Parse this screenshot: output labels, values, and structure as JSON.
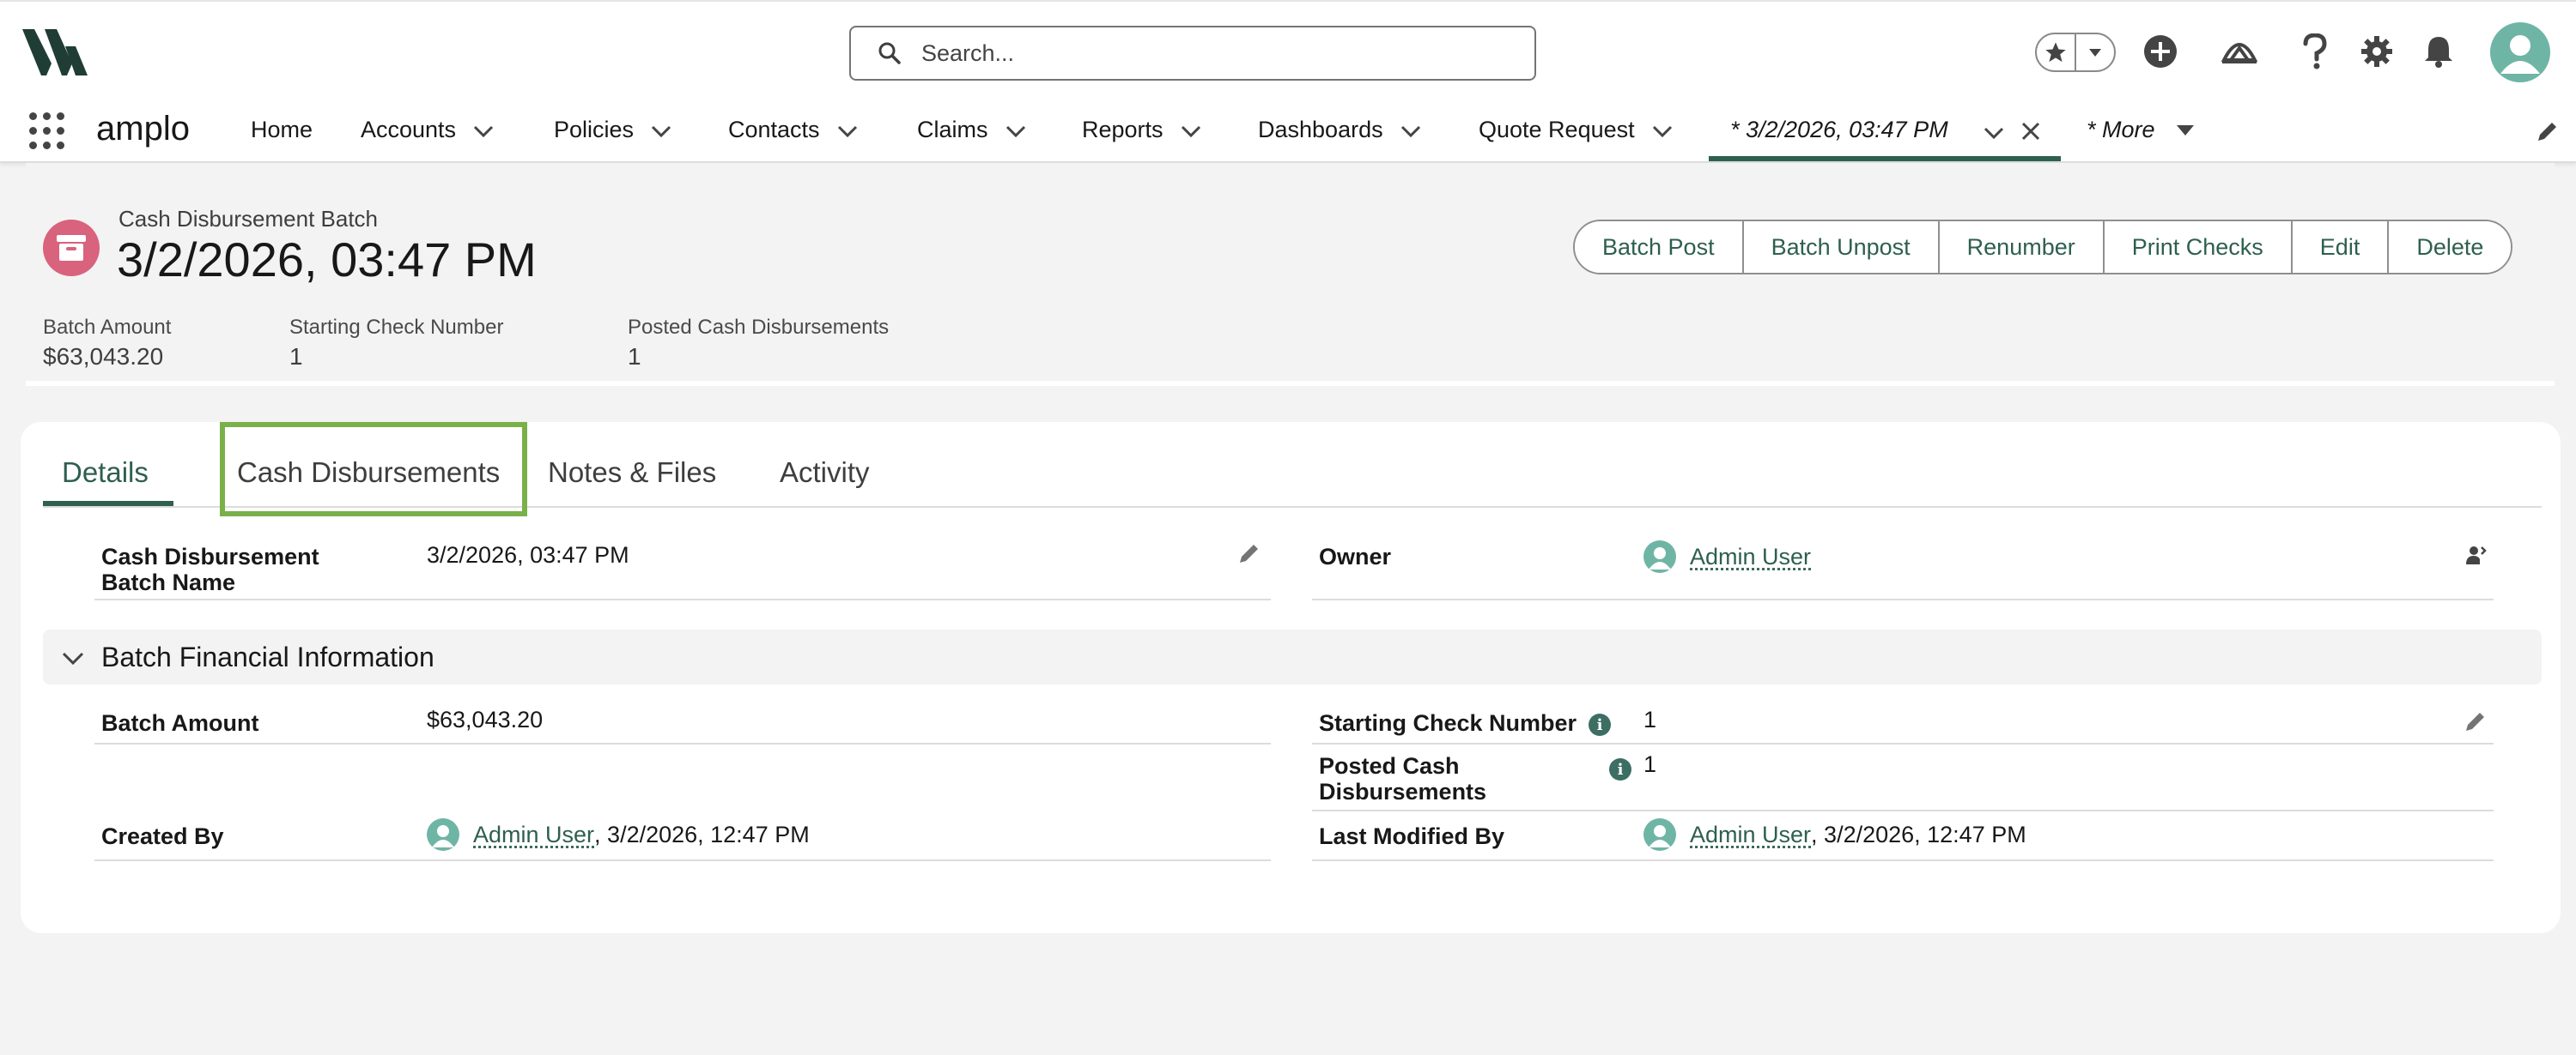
{
  "header": {
    "search_placeholder": "Search...",
    "icons": [
      "logo-icon",
      "search-icon",
      "star-icon",
      "chevron-down-icon",
      "add-icon",
      "trailhead-icon",
      "help-icon",
      "gear-icon",
      "bell-icon",
      "user-avatar-icon"
    ]
  },
  "nav": {
    "app_name": "amplo",
    "items": [
      {
        "label": "Home"
      },
      {
        "label": "Accounts"
      },
      {
        "label": "Policies"
      },
      {
        "label": "Contacts"
      },
      {
        "label": "Claims"
      },
      {
        "label": "Reports"
      },
      {
        "label": "Dashboards"
      },
      {
        "label": "Quote Request"
      }
    ],
    "active_tab": "* 3/2/2026, 03:47 PM",
    "more": "* More"
  },
  "record": {
    "type": "Cash Disbursement Batch",
    "title": "3/2/2026, 03:47 PM",
    "icon_color": "#d9627c",
    "actions": [
      "Batch Post",
      "Batch Unpost",
      "Renumber",
      "Print Checks",
      "Edit",
      "Delete"
    ],
    "highlights": [
      {
        "label": "Batch Amount",
        "value": "$63,043.20"
      },
      {
        "label": "Starting Check Number",
        "value": "1"
      },
      {
        "label": "Posted Cash Disbursements",
        "value": "1"
      }
    ]
  },
  "tabs": {
    "items": [
      "Details",
      "Cash Disbursements",
      "Notes & Files",
      "Activity"
    ],
    "active": "Details"
  },
  "details": {
    "name_label_1": "Cash Disbursement",
    "name_label_2": "Batch Name",
    "name_value": "3/2/2026, 03:47 PM",
    "owner_label": "Owner",
    "owner_value": "Admin User",
    "section_title": "Batch Financial Information",
    "batch_amount_label": "Batch Amount",
    "batch_amount_value": "$63,043.20",
    "starting_check_label": "Starting Check Number",
    "starting_check_value": "1",
    "posted_label_1": "Posted Cash",
    "posted_label_2": "Disbursements",
    "posted_value": "1",
    "created_by_label": "Created By",
    "created_by_user": "Admin User",
    "created_by_date": ", 3/2/2026, 12:47 PM",
    "modified_by_label": "Last Modified By",
    "modified_by_user": "Admin User",
    "modified_by_date": ", 3/2/2026, 12:47 PM"
  },
  "colors": {
    "brand": "#2e5f50",
    "highlight_box": "#7ab04a",
    "avatar": "#6fb5a5"
  }
}
